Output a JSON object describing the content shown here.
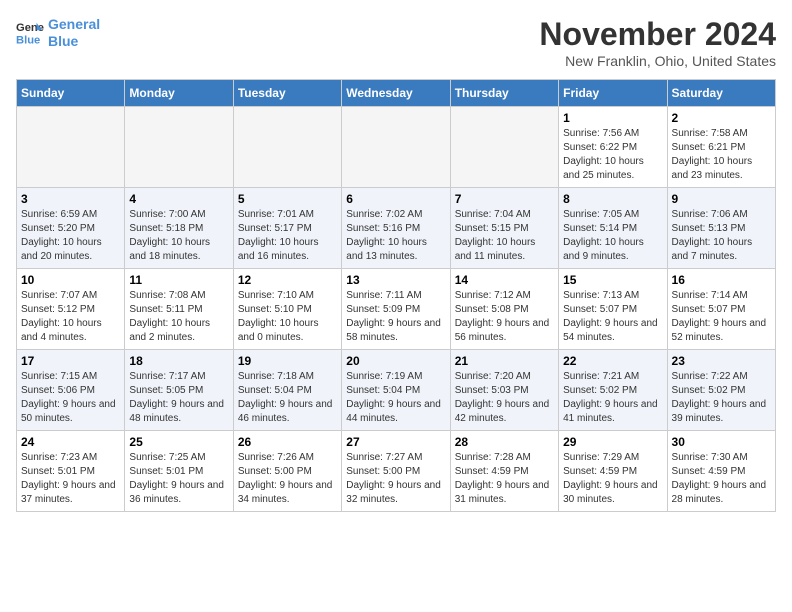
{
  "header": {
    "logo_line1": "General",
    "logo_line2": "Blue",
    "month_title": "November 2024",
    "location": "New Franklin, Ohio, United States"
  },
  "weekdays": [
    "Sunday",
    "Monday",
    "Tuesday",
    "Wednesday",
    "Thursday",
    "Friday",
    "Saturday"
  ],
  "weeks": [
    [
      {
        "day": "",
        "empty": true
      },
      {
        "day": "",
        "empty": true
      },
      {
        "day": "",
        "empty": true
      },
      {
        "day": "",
        "empty": true
      },
      {
        "day": "",
        "empty": true
      },
      {
        "day": "1",
        "sunrise": "Sunrise: 7:56 AM",
        "sunset": "Sunset: 6:22 PM",
        "daylight": "Daylight: 10 hours and 25 minutes."
      },
      {
        "day": "2",
        "sunrise": "Sunrise: 7:58 AM",
        "sunset": "Sunset: 6:21 PM",
        "daylight": "Daylight: 10 hours and 23 minutes."
      }
    ],
    [
      {
        "day": "3",
        "sunrise": "Sunrise: 6:59 AM",
        "sunset": "Sunset: 5:20 PM",
        "daylight": "Daylight: 10 hours and 20 minutes."
      },
      {
        "day": "4",
        "sunrise": "Sunrise: 7:00 AM",
        "sunset": "Sunset: 5:18 PM",
        "daylight": "Daylight: 10 hours and 18 minutes."
      },
      {
        "day": "5",
        "sunrise": "Sunrise: 7:01 AM",
        "sunset": "Sunset: 5:17 PM",
        "daylight": "Daylight: 10 hours and 16 minutes."
      },
      {
        "day": "6",
        "sunrise": "Sunrise: 7:02 AM",
        "sunset": "Sunset: 5:16 PM",
        "daylight": "Daylight: 10 hours and 13 minutes."
      },
      {
        "day": "7",
        "sunrise": "Sunrise: 7:04 AM",
        "sunset": "Sunset: 5:15 PM",
        "daylight": "Daylight: 10 hours and 11 minutes."
      },
      {
        "day": "8",
        "sunrise": "Sunrise: 7:05 AM",
        "sunset": "Sunset: 5:14 PM",
        "daylight": "Daylight: 10 hours and 9 minutes."
      },
      {
        "day": "9",
        "sunrise": "Sunrise: 7:06 AM",
        "sunset": "Sunset: 5:13 PM",
        "daylight": "Daylight: 10 hours and 7 minutes."
      }
    ],
    [
      {
        "day": "10",
        "sunrise": "Sunrise: 7:07 AM",
        "sunset": "Sunset: 5:12 PM",
        "daylight": "Daylight: 10 hours and 4 minutes."
      },
      {
        "day": "11",
        "sunrise": "Sunrise: 7:08 AM",
        "sunset": "Sunset: 5:11 PM",
        "daylight": "Daylight: 10 hours and 2 minutes."
      },
      {
        "day": "12",
        "sunrise": "Sunrise: 7:10 AM",
        "sunset": "Sunset: 5:10 PM",
        "daylight": "Daylight: 10 hours and 0 minutes."
      },
      {
        "day": "13",
        "sunrise": "Sunrise: 7:11 AM",
        "sunset": "Sunset: 5:09 PM",
        "daylight": "Daylight: 9 hours and 58 minutes."
      },
      {
        "day": "14",
        "sunrise": "Sunrise: 7:12 AM",
        "sunset": "Sunset: 5:08 PM",
        "daylight": "Daylight: 9 hours and 56 minutes."
      },
      {
        "day": "15",
        "sunrise": "Sunrise: 7:13 AM",
        "sunset": "Sunset: 5:07 PM",
        "daylight": "Daylight: 9 hours and 54 minutes."
      },
      {
        "day": "16",
        "sunrise": "Sunrise: 7:14 AM",
        "sunset": "Sunset: 5:07 PM",
        "daylight": "Daylight: 9 hours and 52 minutes."
      }
    ],
    [
      {
        "day": "17",
        "sunrise": "Sunrise: 7:15 AM",
        "sunset": "Sunset: 5:06 PM",
        "daylight": "Daylight: 9 hours and 50 minutes."
      },
      {
        "day": "18",
        "sunrise": "Sunrise: 7:17 AM",
        "sunset": "Sunset: 5:05 PM",
        "daylight": "Daylight: 9 hours and 48 minutes."
      },
      {
        "day": "19",
        "sunrise": "Sunrise: 7:18 AM",
        "sunset": "Sunset: 5:04 PM",
        "daylight": "Daylight: 9 hours and 46 minutes."
      },
      {
        "day": "20",
        "sunrise": "Sunrise: 7:19 AM",
        "sunset": "Sunset: 5:04 PM",
        "daylight": "Daylight: 9 hours and 44 minutes."
      },
      {
        "day": "21",
        "sunrise": "Sunrise: 7:20 AM",
        "sunset": "Sunset: 5:03 PM",
        "daylight": "Daylight: 9 hours and 42 minutes."
      },
      {
        "day": "22",
        "sunrise": "Sunrise: 7:21 AM",
        "sunset": "Sunset: 5:02 PM",
        "daylight": "Daylight: 9 hours and 41 minutes."
      },
      {
        "day": "23",
        "sunrise": "Sunrise: 7:22 AM",
        "sunset": "Sunset: 5:02 PM",
        "daylight": "Daylight: 9 hours and 39 minutes."
      }
    ],
    [
      {
        "day": "24",
        "sunrise": "Sunrise: 7:23 AM",
        "sunset": "Sunset: 5:01 PM",
        "daylight": "Daylight: 9 hours and 37 minutes."
      },
      {
        "day": "25",
        "sunrise": "Sunrise: 7:25 AM",
        "sunset": "Sunset: 5:01 PM",
        "daylight": "Daylight: 9 hours and 36 minutes."
      },
      {
        "day": "26",
        "sunrise": "Sunrise: 7:26 AM",
        "sunset": "Sunset: 5:00 PM",
        "daylight": "Daylight: 9 hours and 34 minutes."
      },
      {
        "day": "27",
        "sunrise": "Sunrise: 7:27 AM",
        "sunset": "Sunset: 5:00 PM",
        "daylight": "Daylight: 9 hours and 32 minutes."
      },
      {
        "day": "28",
        "sunrise": "Sunrise: 7:28 AM",
        "sunset": "Sunset: 4:59 PM",
        "daylight": "Daylight: 9 hours and 31 minutes."
      },
      {
        "day": "29",
        "sunrise": "Sunrise: 7:29 AM",
        "sunset": "Sunset: 4:59 PM",
        "daylight": "Daylight: 9 hours and 30 minutes."
      },
      {
        "day": "30",
        "sunrise": "Sunrise: 7:30 AM",
        "sunset": "Sunset: 4:59 PM",
        "daylight": "Daylight: 9 hours and 28 minutes."
      }
    ]
  ]
}
